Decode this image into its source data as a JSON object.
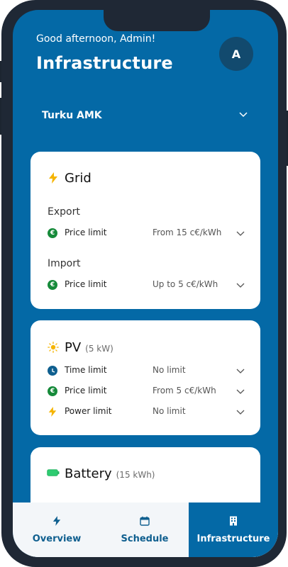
{
  "header": {
    "greeting": "Good afternoon, Admin!",
    "title": "Infrastructure",
    "avatar_initial": "A"
  },
  "location": {
    "selected": "Turku AMK"
  },
  "grid": {
    "title": "Grid",
    "export_label": "Export",
    "export_row": {
      "label": "Price limit",
      "value": "From 15 c€/kWh"
    },
    "import_label": "Import",
    "import_row": {
      "label": "Price limit",
      "value": "Up to 5 c€/kWh"
    }
  },
  "pv": {
    "title": "PV",
    "capacity": "(5 kW)",
    "rows": [
      {
        "label": "Time limit",
        "value": "No limit"
      },
      {
        "label": "Price limit",
        "value": "From 5 c€/kWh"
      },
      {
        "label": "Power limit",
        "value": "No limit"
      }
    ]
  },
  "battery": {
    "title": "Battery",
    "capacity": "(15 kWh)"
  },
  "tabs": [
    {
      "label": "Overview",
      "icon": "bolt-icon"
    },
    {
      "label": "Schedule",
      "icon": "calendar-icon"
    },
    {
      "label": "Infrastructure",
      "icon": "building-icon",
      "active": true
    }
  ],
  "colors": {
    "primary": "#0469a6",
    "accent_yellow": "#f5b400",
    "euro_green": "#168a3a",
    "battery_green": "#2ecc71"
  }
}
